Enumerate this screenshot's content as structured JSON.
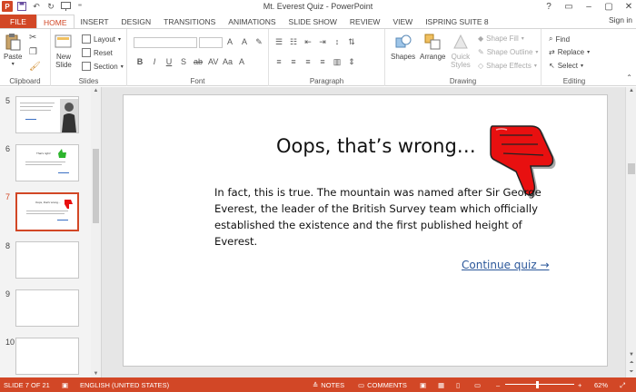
{
  "window": {
    "title": "Mt. Everest Quiz - PowerPoint",
    "controls": [
      "?",
      "▭",
      "–",
      "▢",
      "✕"
    ]
  },
  "tabs": {
    "file": "FILE",
    "items": [
      "HOME",
      "INSERT",
      "DESIGN",
      "TRANSITIONS",
      "ANIMATIONS",
      "SLIDE SHOW",
      "REVIEW",
      "VIEW",
      "ISPRING SUITE 8"
    ],
    "active": "HOME",
    "sign_in": "Sign in"
  },
  "ribbon": {
    "clipboard": {
      "label": "Clipboard",
      "paste": "Paste"
    },
    "slides": {
      "label": "Slides",
      "new_slide_line1": "New",
      "new_slide_line2": "Slide",
      "layout": "Layout",
      "reset": "Reset",
      "section": "Section"
    },
    "font": {
      "label": "Font",
      "font_name": "",
      "font_size": ""
    },
    "paragraph": {
      "label": "Paragraph"
    },
    "drawing": {
      "label": "Drawing",
      "shapes": "Shapes",
      "arrange": "Arrange",
      "quick_styles_line1": "Quick",
      "quick_styles_line2": "Styles",
      "shape_fill": "Shape Fill",
      "shape_outline": "Shape Outline",
      "shape_effects": "Shape Effects"
    },
    "editing": {
      "label": "Editing",
      "find": "Find",
      "replace": "Replace",
      "select": "Select"
    }
  },
  "thumbnails": [
    {
      "num": "5",
      "selected": false,
      "kind": "image"
    },
    {
      "num": "6",
      "selected": false,
      "kind": "correct",
      "mini_title": "That's right!"
    },
    {
      "num": "7",
      "selected": true,
      "kind": "wrong",
      "mini_title": "Oops, that's wrong..."
    },
    {
      "num": "8",
      "selected": false,
      "kind": "blank"
    },
    {
      "num": "9",
      "selected": false,
      "kind": "blank"
    },
    {
      "num": "10",
      "selected": false,
      "kind": "blank"
    }
  ],
  "slide": {
    "title": "Oops, that’s wrong…",
    "body": "In fact, this is true. The mountain was named after Sir George Everest, the leader of the British Survey team which officially established the existence and the first published height of Everest.",
    "link": "Continue quiz →"
  },
  "statusbar": {
    "slide_info": "SLIDE 7 OF 21",
    "language": "ENGLISH (UNITED STATES)",
    "notes": "NOTES",
    "comments": "COMMENTS",
    "zoom": "62%",
    "zoom_minus": "–",
    "zoom_plus": "+"
  },
  "colors": {
    "accent": "#d24726",
    "link": "#2b579a",
    "thumb_red": "#e81010"
  }
}
